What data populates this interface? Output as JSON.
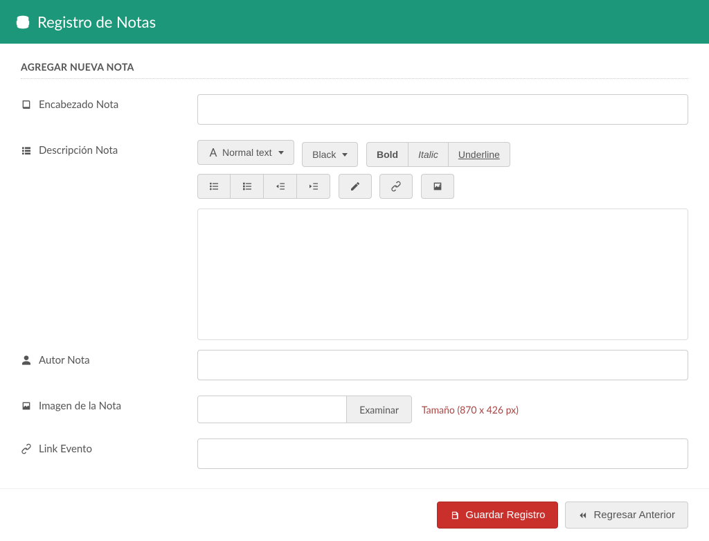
{
  "header": {
    "title": "Registro de Notas"
  },
  "section": {
    "title": "AGREGAR NUEVA NOTA"
  },
  "form": {
    "heading_label": "Encabezado Nota",
    "heading_value": "",
    "description_label": "Descripción Nota",
    "author_label": "Autor Nota",
    "author_value": "",
    "image_label": "Imagen de la Nota",
    "file_button": "Examinar",
    "file_value": "",
    "size_hint": "Tamaño (870 x 426 px)",
    "link_label": "Link Evento",
    "link_value": ""
  },
  "editor": {
    "font_style": "Normal text",
    "font_color": "Black",
    "bold": "Bold",
    "italic": "Italic",
    "underline": "Underline"
  },
  "actions": {
    "save": "Guardar Registro",
    "back": "Regresar Anterior"
  }
}
